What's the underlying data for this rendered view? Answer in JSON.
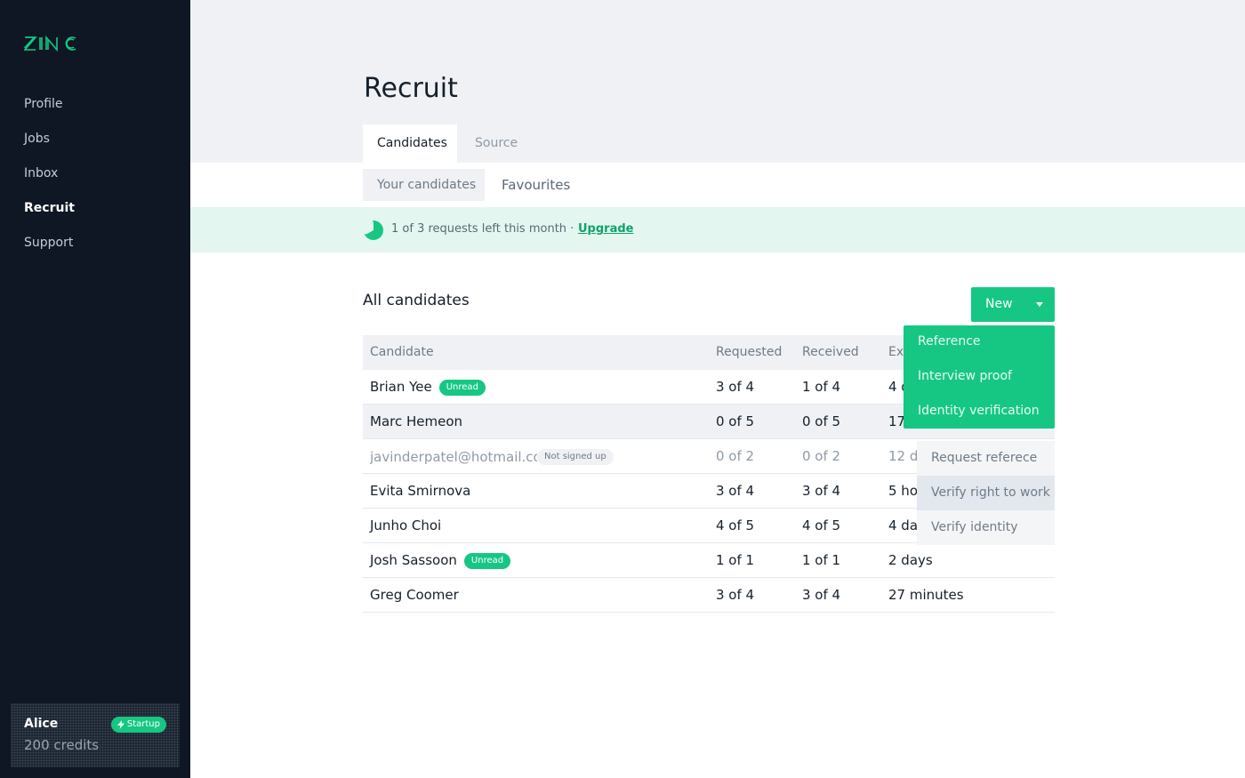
{
  "app": {
    "logo_text": "ZINC",
    "brand_color": "#16c784",
    "sidebar_bg": "#0e1723"
  },
  "sidebar": {
    "items": [
      {
        "label": "Profile",
        "active": false
      },
      {
        "label": "Jobs",
        "active": false
      },
      {
        "label": "Inbox",
        "active": false
      },
      {
        "label": "Recruit",
        "active": true
      },
      {
        "label": "Support",
        "active": false
      }
    ],
    "account": {
      "name": "Alice",
      "credits": "200 credits",
      "plan": "Startup",
      "plan_icon": "lightning-icon"
    }
  },
  "page": {
    "title": "Recruit"
  },
  "tabs": [
    {
      "label": "Candidates",
      "active": true
    },
    {
      "label": "Source",
      "active": false
    }
  ],
  "subtabs": [
    {
      "label": "Your candidates",
      "active": true
    },
    {
      "label": "Favourites",
      "active": false
    }
  ],
  "banner": {
    "text": "1 of 3 requests left this month ·",
    "link": "Upgrade",
    "used_fraction": 0.33
  },
  "section": {
    "title": "All candidates",
    "new_button": "New"
  },
  "table": {
    "columns": [
      "Candidate",
      "Requested",
      "Received",
      "Ex"
    ],
    "rows": [
      {
        "name": "Brian Yee",
        "badge": "Unread",
        "requested": "3 of 4",
        "received": "1 of 4",
        "expires": "4 d"
      },
      {
        "name": "Marc Hemeon",
        "badge": "",
        "requested": "0 of 5",
        "received": "0 of 5",
        "expires": "17"
      },
      {
        "name": "javinderpatel@hotmail.com",
        "badge": "Not signed up",
        "requested": "0 of 2",
        "received": "0 of 2",
        "expires": "12 d"
      },
      {
        "name": "Evita Smirnova",
        "badge": "",
        "requested": "3 of 4",
        "received": "3 of 4",
        "expires": "5 ho"
      },
      {
        "name": "Junho Choi",
        "badge": "",
        "requested": "4 of 5",
        "received": "4 of 5",
        "expires": "4 da"
      },
      {
        "name": "Josh Sassoon",
        "badge": "Unread",
        "requested": "1 of 1",
        "received": "1 of 1",
        "expires": "2 days"
      },
      {
        "name": "Greg Coomer",
        "badge": "",
        "requested": "3 of 4",
        "received": "3 of 4",
        "expires": "27 minutes"
      }
    ]
  },
  "new_menu": {
    "items": [
      "Reference",
      "Interview proof",
      "Identity verification"
    ]
  },
  "row_menu": {
    "items": [
      "Request referece",
      "Verify right to work",
      "Verify identity"
    ]
  }
}
